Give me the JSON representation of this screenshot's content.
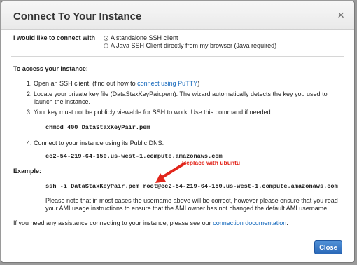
{
  "dialog": {
    "title": "Connect To Your Instance",
    "close_icon": "×"
  },
  "connect_option": {
    "label": "I would like to connect with",
    "options": [
      {
        "label": "A standalone SSH client",
        "selected": true
      },
      {
        "label": "A Java SSH Client directly from my browser (Java required)",
        "selected": false
      }
    ]
  },
  "access": {
    "heading": "To access your instance:",
    "step1": {
      "num": "1.",
      "text": "Open an SSH client. (find out how to",
      "link": "connect using PuTTY",
      "suffix": ")"
    },
    "step2": {
      "num": "2.",
      "line1": "Locate your private key file (DataStaxKeyPair.pem). The wizard automatically detects the key you used to",
      "line2": "launch the instance."
    },
    "step3": {
      "num": "3.",
      "text": "Your key must not be publicly viewable for SSH to work. Use this command if needed:"
    },
    "chmod_command": "chmod 400 DataStaxKeyPair.pem",
    "step4": {
      "num": "4.",
      "text": "Connect to your instance using its Public DNS:"
    },
    "public_dns": "ec2-54-219-64-150.us-west-1.compute.amazonaws.com"
  },
  "annotation": {
    "text": "Replace with ubuntu",
    "color": "#e2261c"
  },
  "example": {
    "heading": "Example:",
    "command": "ssh -i DataStaxKeyPair.pem root@ec2-54-219-64-150.us-west-1.compute.amazonaws.com",
    "note_line1": "Please note that in most cases the username above will be correct, however please ensure that you read",
    "note_line2": "your AMI usage instructions to ensure that the AMI owner has not changed the default AMI username."
  },
  "assistance": {
    "text": "If you need any assistance connecting to your instance, please see our",
    "link": "connection documentation",
    "suffix": "."
  },
  "footer": {
    "close_label": "Close"
  },
  "colors": {
    "link": "#1166bb",
    "button": "#2a68b8",
    "annotation": "#e2261c"
  }
}
